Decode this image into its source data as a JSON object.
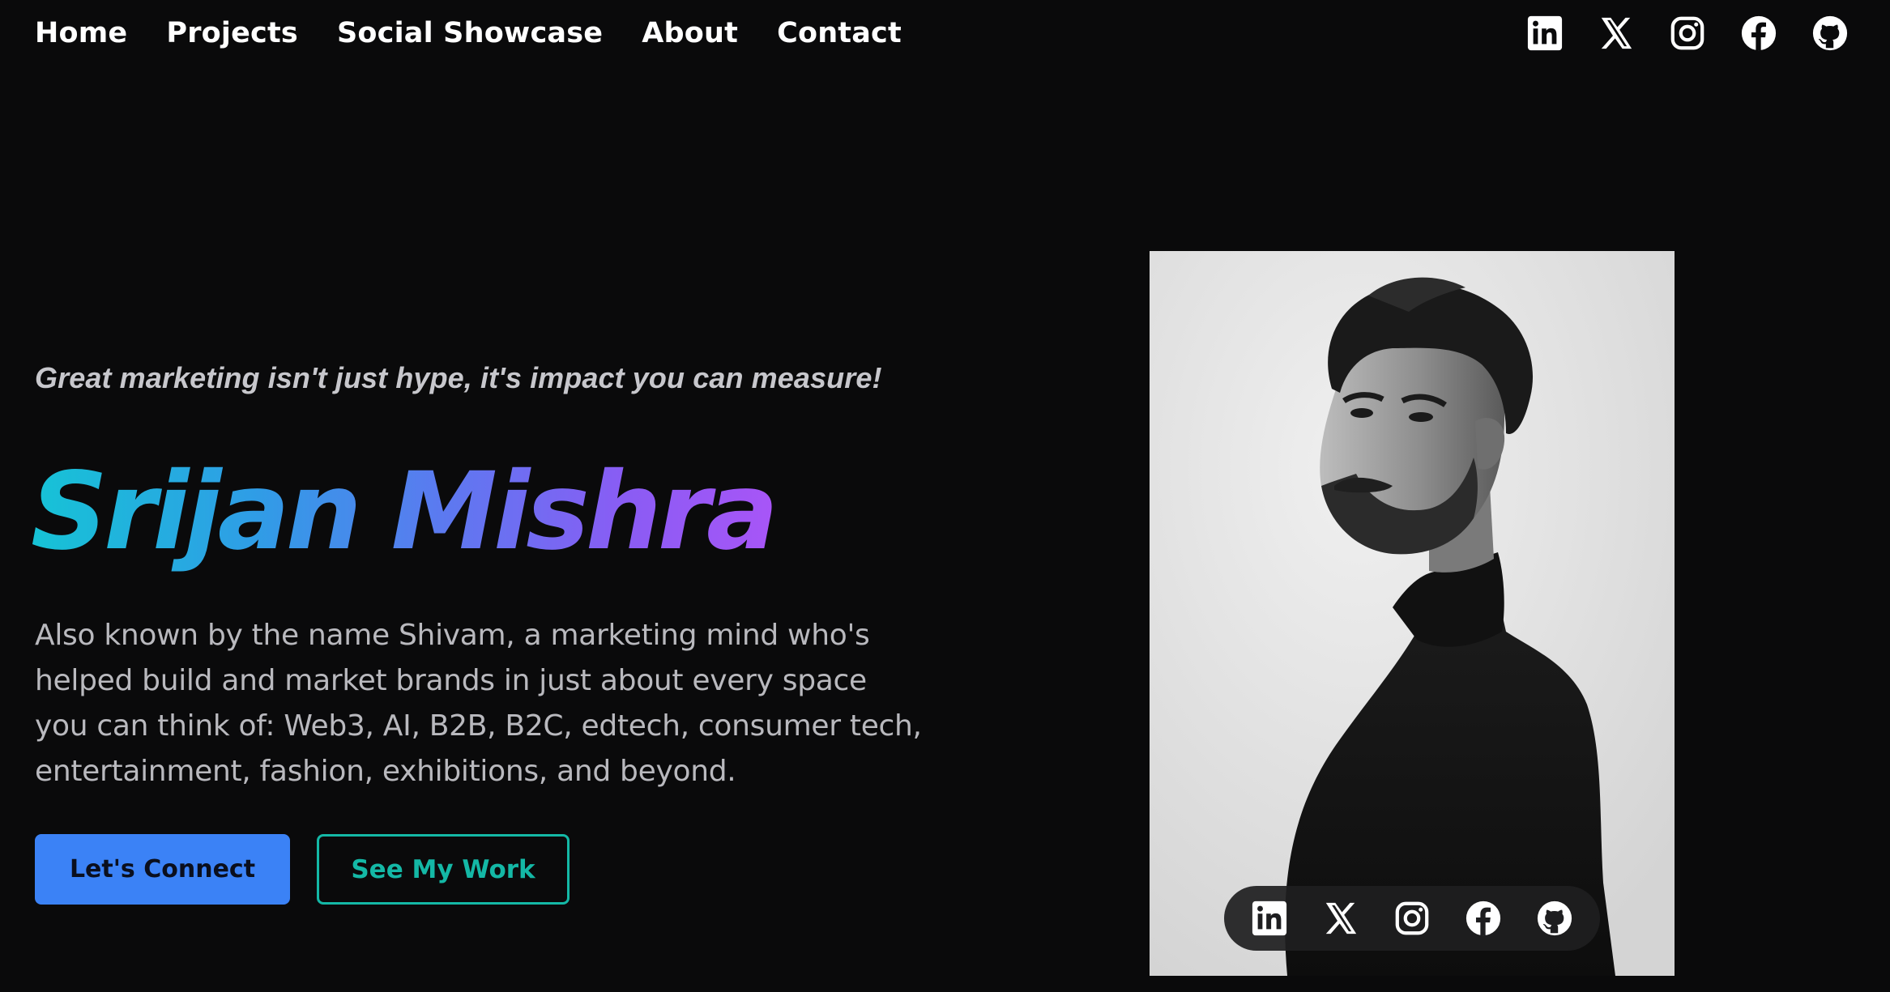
{
  "nav": {
    "items": [
      "Home",
      "Projects",
      "Social Showcase",
      "About",
      "Contact"
    ]
  },
  "social": {
    "icons": [
      "linkedin-icon",
      "x-icon",
      "instagram-icon",
      "facebook-icon",
      "github-icon"
    ],
    "color": "#ffffff"
  },
  "hero": {
    "tagline": "Great marketing isn't just hype, it's impact you can measure!",
    "name": "Srijan Mishra",
    "bio": "Also known by the name Shivam, a marketing mind who's helped build and market brands in just about every space you can think of: Web3, AI, B2B, B2C, edtech, consumer tech, entertainment, fashion, exhibitions, and beyond.",
    "primary_button": "Let's Connect",
    "secondary_button": "See My Work"
  },
  "colors": {
    "background": "#0a0a0b",
    "name_gradient_start": "#16c3d6",
    "name_gradient_end": "#a855f7",
    "primary_button": "#3b82f6",
    "secondary_button": "#14b8a6"
  }
}
